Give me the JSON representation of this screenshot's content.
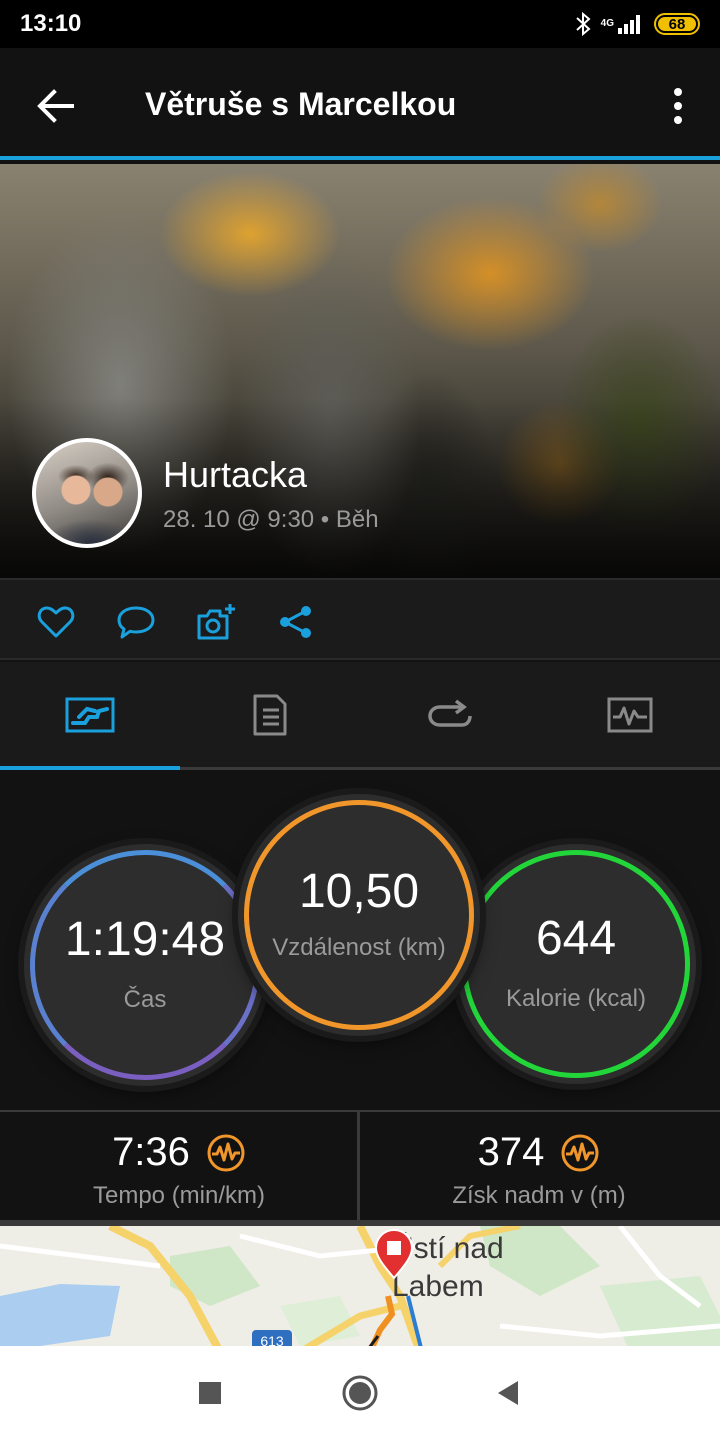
{
  "status_bar": {
    "time": "13:10",
    "network": "4G",
    "battery": "68"
  },
  "app_bar": {
    "title": "Větruše s Marcelkou"
  },
  "activity": {
    "name": "Hurtacka",
    "meta": "28. 10 @ 9:30 • Běh"
  },
  "stats": {
    "time": {
      "value": "1:19:48",
      "label": "Čas"
    },
    "distance": {
      "value": "10,50",
      "label": "Vzdálenost (km)"
    },
    "calories": {
      "value": "644",
      "label": "Kalorie (kcal)"
    }
  },
  "metrics": [
    {
      "value": "7:36",
      "label": "Tempo (min/km)"
    },
    {
      "value": "374",
      "label": "Získ nadm v (m)"
    }
  ],
  "map": {
    "city": "Ústí nad\nLabem",
    "road_badge": "613"
  },
  "colors": {
    "accent": "#1aa0dc",
    "time_ring": "#4b8fd8",
    "distance_ring": "#f0962a",
    "calories_ring": "#22d63a",
    "metric_icon": "#f0962a"
  }
}
